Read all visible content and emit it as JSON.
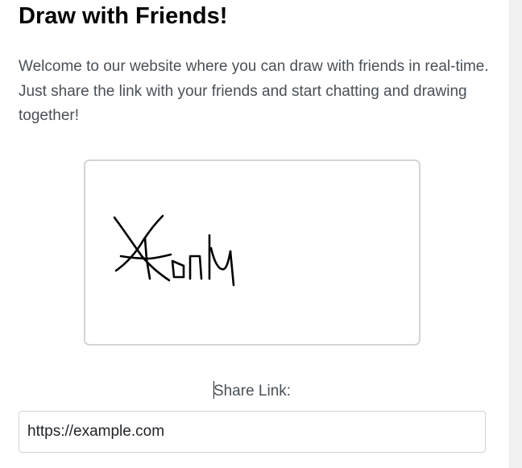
{
  "header": {
    "title": "Draw with Friends!"
  },
  "intro": {
    "text": "Welcome to our website where you can draw with friends in real-time. Just share the link with your friends and start chatting and drawing together!"
  },
  "drawing": {
    "stroke_color": "#000000",
    "border_color": "#d3d5d8"
  },
  "share": {
    "label": "Share Link:",
    "value": "https://example.com"
  }
}
